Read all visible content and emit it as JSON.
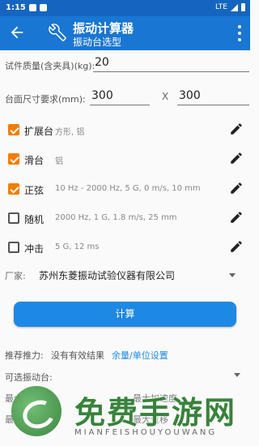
{
  "status": {
    "time": "1:15",
    "network": "LTE"
  },
  "appbar": {
    "title": "振动计算器",
    "subtitle": "振动台选型"
  },
  "form": {
    "mass_label": "试件质量(含夹具)(kg):",
    "mass_value": "20",
    "size_label": "台面尺寸要求(mm):",
    "size_w": "300",
    "size_sep": "X",
    "size_h": "300"
  },
  "options": [
    {
      "checked": true,
      "name": "扩展台",
      "desc": "方形, 铝"
    },
    {
      "checked": true,
      "name": "滑台",
      "desc": "铝"
    },
    {
      "checked": true,
      "name": "正弦",
      "desc": "10 Hz - 2000 Hz, 5 G, 0 m/s, 10 mm"
    },
    {
      "checked": false,
      "name": "随机",
      "desc": "2000 Hz, 1 G, 1.8 m/s, 25 mm"
    },
    {
      "checked": false,
      "name": "冲击",
      "desc": "5 G, 12 ms"
    }
  ],
  "vendor": {
    "label": "厂家:",
    "value": "苏州东菱振动试验仪器有限公司"
  },
  "calc_button": "计算",
  "result": {
    "thrust_label": "推荐推力:",
    "thrust_value": "没有有效结果",
    "margin_link": "余量/单位设置",
    "available_label": "可选振动台:",
    "row1_left": "最大",
    "row1_right": "最大加速度",
    "row2_left": "最",
    "row2_right": "最大位移"
  },
  "watermark": {
    "text": "免费手游网",
    "sub": "MIANFEISHOUYOUWANG"
  },
  "colors": {
    "primary": "#1976d2",
    "accent": "#f57c00",
    "button": "#1e88e5"
  }
}
